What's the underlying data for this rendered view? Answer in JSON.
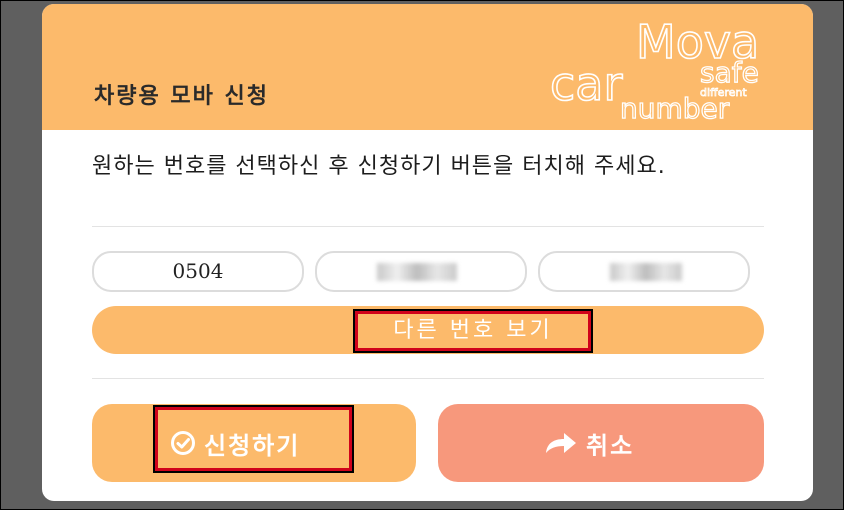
{
  "dialog": {
    "title": "차량용 모바 신청",
    "description": "원하는 번호를 선택하신 후 신청하기 버튼을 터치해 주세요."
  },
  "logo": {
    "line1": "Mova",
    "line2_a": "car",
    "line2_b": "safe",
    "small": "different",
    "line3": "number"
  },
  "number": {
    "part1": "0504",
    "part2": "",
    "part3": ""
  },
  "buttons": {
    "other_number": "다른 번호 보기",
    "apply": "신청하기",
    "cancel": "취소"
  },
  "icons": {
    "apply_icon": "check-circle-icon",
    "cancel_icon": "share-arrow-icon"
  },
  "colors": {
    "accent": "#fcba6b",
    "cancel": "#f7987c",
    "highlight_border": "#d0021b"
  }
}
